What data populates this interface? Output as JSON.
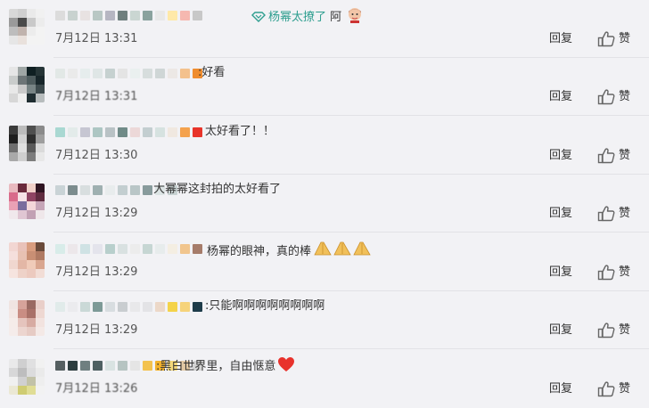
{
  "actions": {
    "reply_label": "回复",
    "like_label": "赞"
  },
  "comments": [
    {
      "pre": "",
      "highlight": "杨幂太撩了",
      "text": " 阿",
      "time": "7月12日 13:31",
      "avatar": [
        "#d8d8d8",
        "#cfcfcf",
        "#eaeaea",
        "#f1f1f1",
        "#9a9a9a",
        "#4a4a4a",
        "#c9c9c9",
        "#ececec",
        "#bdbdbd",
        "#c0b3ad",
        "#ececec",
        "#f3f3f3",
        "#e6e6e6",
        "#e9e1dc",
        "#f3f3f3",
        "#f3f3f3"
      ],
      "mosaic": [
        "#dcdcdc",
        "#c8d2cf",
        "#e8e2e2",
        "#b8c7c4",
        "#b6b6c2",
        "#6f7f7e",
        "#cad6d2",
        "#8aa29e",
        "#e8e8e8",
        "#ffe9a8",
        "#f6b8b0",
        "#c8c8c8"
      ]
    },
    {
      "pre": ":",
      "text": "好看",
      "time": "7月12日 13:31",
      "avatar": [
        "#e6e6e6",
        "#9fa6a5",
        "#0f1f22",
        "#253436",
        "#c9cccb",
        "#6d7577",
        "#4e5b5d",
        "#18262a",
        "#e8e8e8",
        "#c9c9c9",
        "#788485",
        "#3d4a4d",
        "#d7d7d7",
        "#eeeeee",
        "#1f2d31",
        "#b7bcbd"
      ],
      "mosaic": [
        "#e2e8e6",
        "#eaeaea",
        "#e6eded",
        "#dfe6e6",
        "#c6d1d0",
        "#e4e4e4",
        "#eaf0ef",
        "#d7dddd",
        "#cfd6d6",
        "#ece8e5",
        "#f3c18d",
        "#ef8d2f"
      ]
    },
    {
      "pre": "",
      "text": "太好看了！！",
      "time": "7月12日 13:30",
      "avatar": [
        "#3a3a3a",
        "#bcbcbc",
        "#4f4f4f",
        "#8a8a8a",
        "#1e1e1e",
        "#d2d2d2",
        "#2f2f2f",
        "#9e9e9e",
        "#6e6e6e",
        "#e0e0e0",
        "#5a5a5a",
        "#dadada",
        "#a9a9a9",
        "#cfcfcf",
        "#7d7d7d",
        "#e8e8e8"
      ],
      "mosaic": [
        "#a9d8d2",
        "#e3ebea",
        "#c6c6d2",
        "#adc6c3",
        "#b9c2c5",
        "#708b88",
        "#ecd8d8",
        "#c3ced0",
        "#d6e2e0",
        "#f0e8e0",
        "#f4a24d",
        "#e8342a"
      ]
    },
    {
      "pre": "",
      "text": "大幂幂这封拍的太好看了",
      "time": "7月12日 13:29",
      "avatar": [
        "#e9b9bf",
        "#6a2a3c",
        "#f0d0c8",
        "#2e1522",
        "#d96b8b",
        "#f6e2e6",
        "#8f4463",
        "#5f2c40",
        "#e9a1b5",
        "#7a6c9d",
        "#f3d7d9",
        "#c6a6b8",
        "#f0e8ec",
        "#e0c6d3",
        "#c2a1b4",
        "#efe7ea"
      ],
      "mosaic": [
        "#c9d3d6",
        "#7c8c8e",
        "#d8dedf",
        "#9fb0b1",
        "#e8eced",
        "#c3ced0",
        "#b9c6c7",
        "#889b9c",
        "#dce4e4",
        "#c8d2d2"
      ]
    },
    {
      "pre": "",
      "text": "杨幂的眼神，真的棒",
      "time": "7月12日 13:29",
      "avatar": [
        "#f2d6d2",
        "#e9c2b9",
        "#d89c7e",
        "#6a4a3a",
        "#f5dfdc",
        "#e8c1b2",
        "#c98f74",
        "#b07a63",
        "#f0d7cf",
        "#e3b7a6",
        "#f0cbb9",
        "#d9a690",
        "#f6e4df",
        "#eed2c8",
        "#eccabf",
        "#f2ddd6"
      ],
      "mosaic": [
        "#d8ece9",
        "#ece7ea",
        "#cfe2e4",
        "#e4e4ec",
        "#b8cfcc",
        "#d9e1e1",
        "#ececec",
        "#c6d6d3",
        "#e7ecec",
        "#f4eee2",
        "#f1c58d",
        "#a67c6a"
      ]
    },
    {
      "pre": ":",
      "text": "只能啊啊啊啊啊啊啊啊",
      "time": "7月12日 13:29",
      "avatar": [
        "#f0e4e1",
        "#d6a39a",
        "#9a6a62",
        "#e9cfc9",
        "#f3e7e4",
        "#c98d83",
        "#a97168",
        "#eed8d2",
        "#f5ece9",
        "#e5c4bd",
        "#d7aba2",
        "#f2e3df",
        "#f5ecea",
        "#ecd5cf",
        "#e6cbc4",
        "#f4e9e6"
      ],
      "mosaic": [
        "#e1ebea",
        "#ebebee",
        "#cad9d7",
        "#7d9a97",
        "#d8dde0",
        "#c9cdd0",
        "#e8e8ea",
        "#e3e3e6",
        "#ecd8c8",
        "#f4d34a",
        "#f6d37a",
        "#1e3c4a"
      ]
    },
    {
      "pre": ":",
      "text": "黑白世界里，自由惬意",
      "time": "7月12日 13:26",
      "avatar": [
        "#e9e9ea",
        "#cfcfd0",
        "#e0e0e1",
        "#f1f1f1",
        "#d7d7d8",
        "#bdbdbe",
        "#dcdcdd",
        "#eaeaea",
        "#f0f0f0",
        "#d0d0d1",
        "#c2c2a8",
        "#eeeeee",
        "#ebe8d4",
        "#cfcc72",
        "#e0dd95",
        "#f2f2f2"
      ],
      "mosaic": [
        "#555f61",
        "#2d3d3f",
        "#6f7f80",
        "#4e6062",
        "#d9e3e2",
        "#b6c4c2",
        "#e5e5e5",
        "#f3c24f",
        "#f2b12b",
        "#f4d87a",
        "#e2c8a3",
        "#d4d4d4"
      ]
    }
  ]
}
